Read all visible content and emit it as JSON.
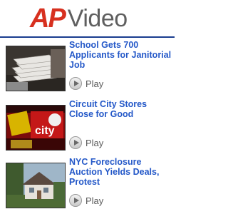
{
  "header": {
    "logo_ap": "AP",
    "logo_video": "Video",
    "rule_color": "#1a3d8f"
  },
  "videos": [
    {
      "title": "School Gets 700 Applicants for Janitorial Job",
      "play_label": "Play",
      "thumb_icon": "paper-stack-thumbnail"
    },
    {
      "title": "Circuit City Stores Close for Good",
      "play_label": "Play",
      "thumb_icon": "circuit-city-sign-thumbnail"
    },
    {
      "title": "NYC Foreclosure Auction Yields Deals, Protest",
      "play_label": "Play",
      "thumb_icon": "house-thumbnail"
    }
  ],
  "colors": {
    "accent_red": "#d7301f",
    "link_blue": "#2458c8",
    "text_gray": "#5a5a5a"
  }
}
